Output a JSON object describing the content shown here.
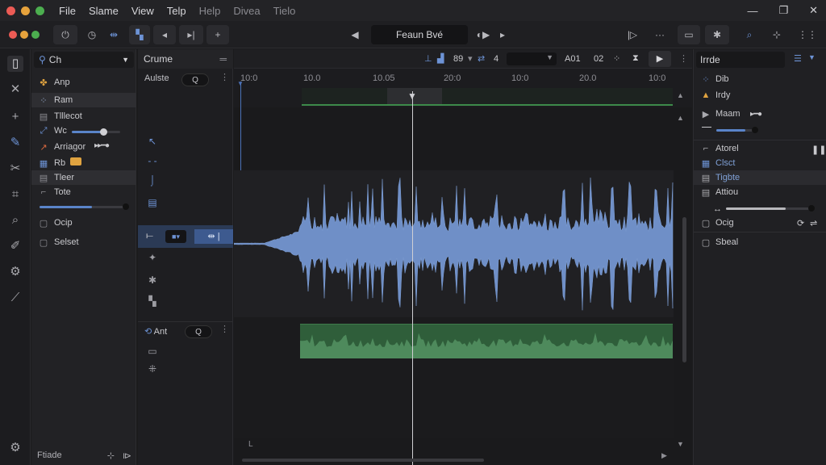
{
  "menubar": {
    "traffic_colors": [
      "#ec5b55",
      "#e6a23c",
      "#4cae4f"
    ],
    "items": [
      "File",
      "Slame",
      "View",
      "Telp",
      "Help",
      "Divea",
      "Tielo"
    ],
    "window_controls": [
      "—",
      "❐",
      "✕"
    ]
  },
  "toolbar": {
    "title": "Feaun Bvé",
    "transport": [
      "◀",
      "◐▶",
      "▸"
    ],
    "right_icons": [
      "|▷",
      "···",
      "▭",
      "✱",
      "⌕",
      "⊹",
      "⋮⋮"
    ]
  },
  "left_panel": {
    "header": "Ch",
    "rows": [
      {
        "icon": "✤",
        "label": "Anp",
        "color": "#e0a340"
      },
      {
        "icon": "⁘",
        "label": "Ram",
        "color": "#9fb3d9"
      },
      {
        "icon": "▤",
        "label": "Tlllecot",
        "color": "#8d8d93"
      },
      {
        "icon": "⤢",
        "label": "Wc",
        "color": "#6d93d6"
      },
      {
        "icon": "↗",
        "label": "Arriagor",
        "color": "#d9683f"
      },
      {
        "icon": "▦",
        "label": "Rb",
        "color": "#6d93d6"
      },
      {
        "icon": "▤",
        "label": "Tleer",
        "color": "#8d8d93"
      },
      {
        "icon": "⌐",
        "label": "Tote",
        "color": "#8d8d93"
      },
      {
        "icon": "▢",
        "label": "Ocip",
        "color": "#8d8d93"
      },
      {
        "icon": "▢",
        "label": "Selset",
        "color": "#8d8d93"
      }
    ],
    "wc_level": 0.65,
    "tote_level": 0.6,
    "footer": "Ftiade"
  },
  "track_column": {
    "header": "Crume",
    "track1_label": "Aulste",
    "track3_label": "Ant"
  },
  "timeline": {
    "top_values": [
      "89",
      "4",
      "A01",
      "02"
    ],
    "ruler_labels": [
      "10:0",
      "10.0",
      "10.05",
      "20:0",
      "10:0",
      "20.0",
      "10:0"
    ],
    "playhead_marker": "▼"
  },
  "right_panel": {
    "header": "Irrde",
    "rows": [
      {
        "icon": "⁘",
        "label": "Dib"
      },
      {
        "icon": "▲",
        "label": "Irdy"
      },
      {
        "icon": "▶",
        "label": "Maam"
      },
      {
        "icon": "⌐",
        "label": "Atorel"
      },
      {
        "icon": "▦",
        "label": "Clsct"
      },
      {
        "icon": "▤",
        "label": "Tigbte"
      },
      {
        "icon": "▤",
        "label": "Attiou"
      },
      {
        "icon": "▢",
        "label": "Ocig"
      },
      {
        "icon": "▢",
        "label": "Sbeal"
      }
    ],
    "maam_level": 0.75,
    "attiou_level": 0.7
  }
}
